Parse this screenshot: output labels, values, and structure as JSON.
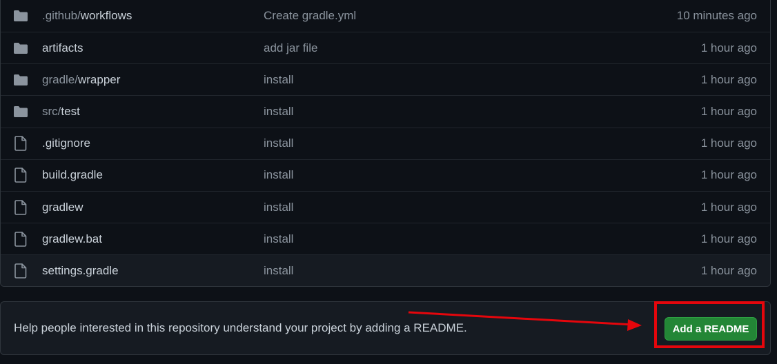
{
  "files": [
    {
      "type": "folder",
      "icon": "folder-icon",
      "dir": ".github/",
      "leaf": "workflows",
      "message": "Create gradle.yml",
      "time": "10 minutes ago"
    },
    {
      "type": "folder",
      "icon": "folder-icon",
      "dir": "",
      "leaf": "artifacts",
      "message": "add jar file",
      "time": "1 hour ago"
    },
    {
      "type": "folder",
      "icon": "folder-icon",
      "dir": "gradle/",
      "leaf": "wrapper",
      "message": "install",
      "time": "1 hour ago"
    },
    {
      "type": "folder",
      "icon": "folder-icon",
      "dir": "src/",
      "leaf": "test",
      "message": "install",
      "time": "1 hour ago"
    },
    {
      "type": "file",
      "icon": "file-icon",
      "dir": "",
      "leaf": ".gitignore",
      "message": "install",
      "time": "1 hour ago"
    },
    {
      "type": "file",
      "icon": "file-icon",
      "dir": "",
      "leaf": "build.gradle",
      "message": "install",
      "time": "1 hour ago"
    },
    {
      "type": "file",
      "icon": "file-icon",
      "dir": "",
      "leaf": "gradlew",
      "message": "install",
      "time": "1 hour ago"
    },
    {
      "type": "file",
      "icon": "file-icon",
      "dir": "",
      "leaf": "gradlew.bat",
      "message": "install",
      "time": "1 hour ago"
    },
    {
      "type": "file",
      "icon": "file-icon",
      "dir": "",
      "leaf": "settings.gradle",
      "message": "install",
      "time": "1 hour ago"
    }
  ],
  "readme_banner": {
    "text": "Help people interested in this repository understand your project by adding a README.",
    "button_label": "Add a README"
  },
  "colors": {
    "background": "#0d1117",
    "border": "#30363d",
    "text": "#c9d1d9",
    "muted": "#8b949e",
    "button_green": "#238636",
    "annotation_red": "#e5060c"
  }
}
